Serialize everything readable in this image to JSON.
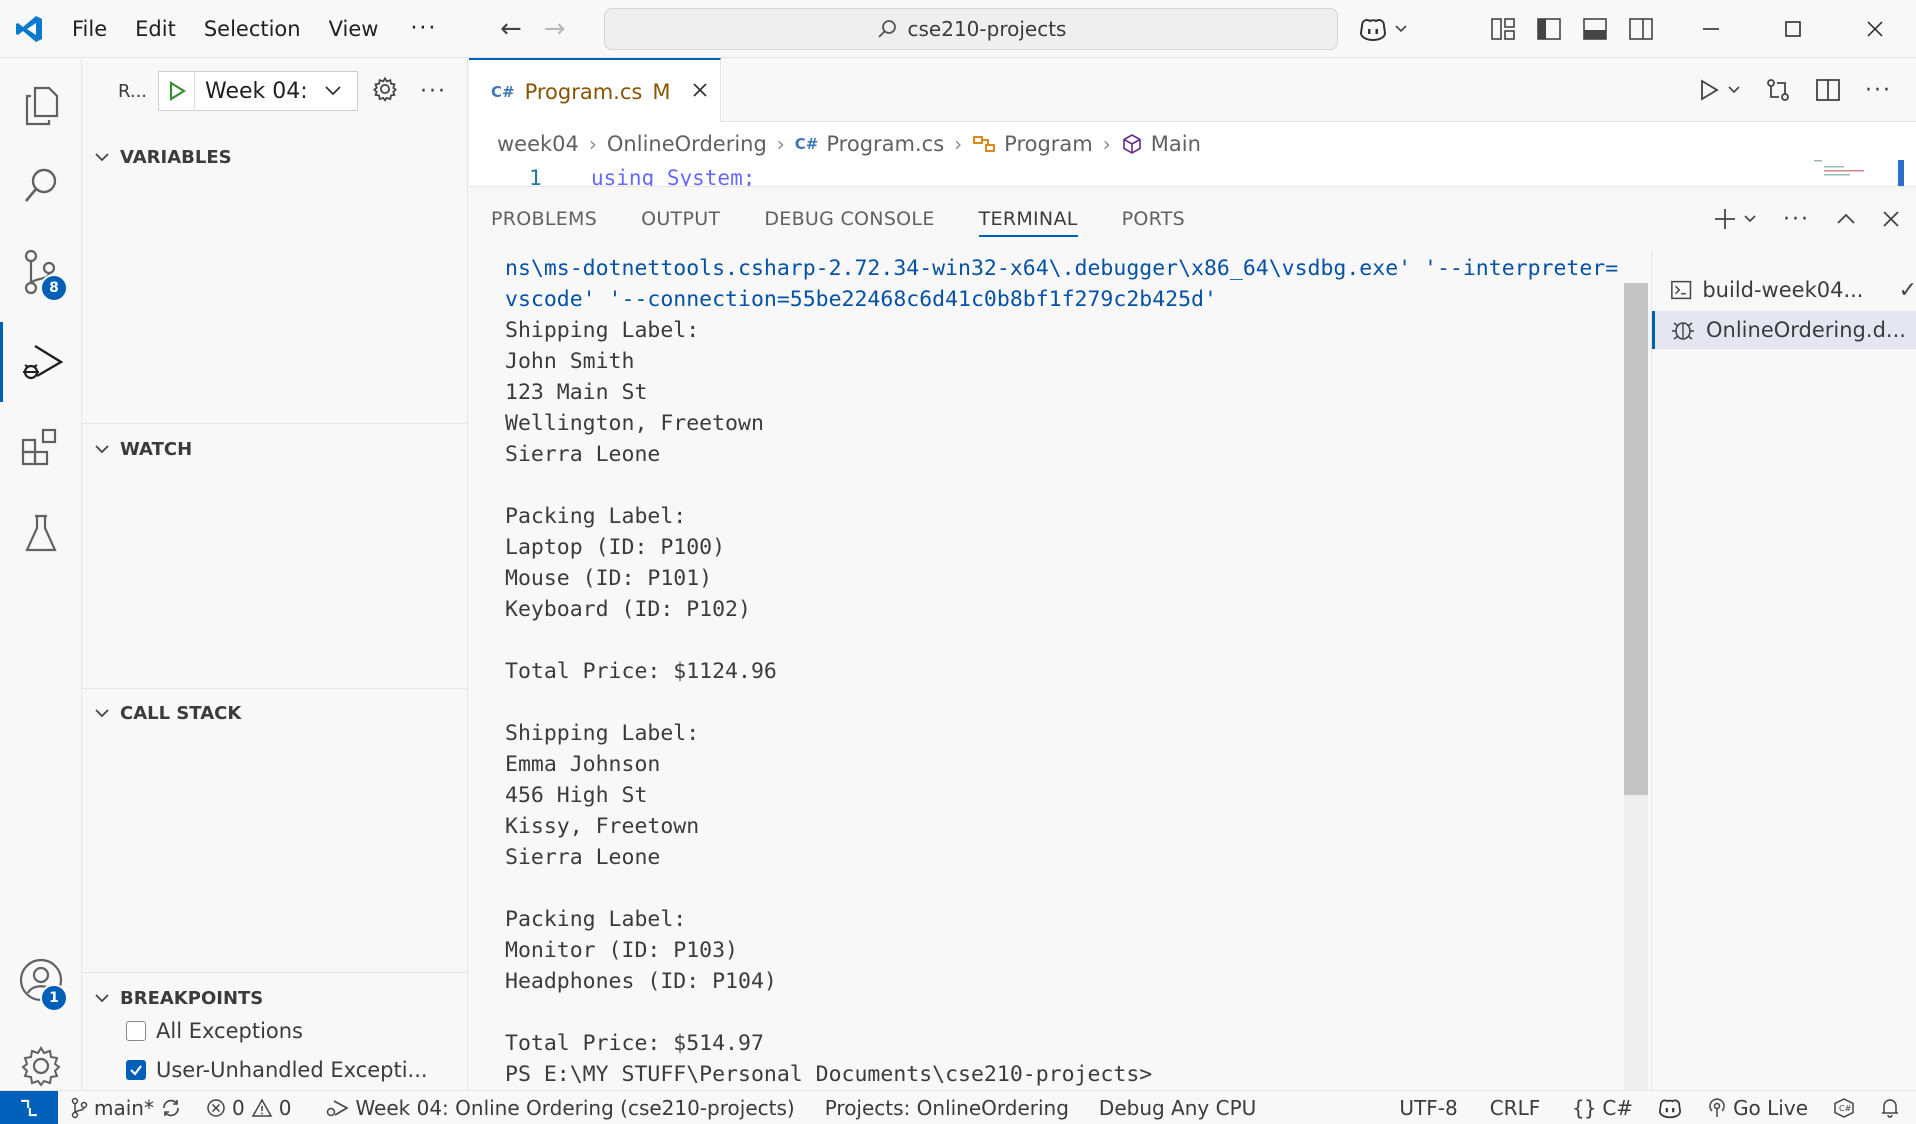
{
  "titlebar": {
    "menus": [
      "File",
      "Edit",
      "Selection",
      "View"
    ],
    "more": "···",
    "search_text": "cse210-projects"
  },
  "activitybar": {
    "source_control_badge": "8",
    "accounts_badge": "1"
  },
  "sidebar": {
    "run_label": "R...",
    "config_name": "Week 04: Online Ordering",
    "more": "···",
    "sections": {
      "variables": "VARIABLES",
      "watch": "WATCH",
      "call_stack": "CALL STACK",
      "breakpoints": "BREAKPOINTS"
    },
    "breakpoints": [
      {
        "label": "All Exceptions",
        "checked": false
      },
      {
        "label": "User-Unhandled Excepti...",
        "checked": true
      }
    ]
  },
  "editor": {
    "tab": {
      "icon_text": "C#",
      "name": "Program.cs",
      "modified": "M"
    },
    "breadcrumb": [
      "week04",
      "OnlineOrdering",
      "Program.cs",
      "Program",
      "Main"
    ],
    "line_number": "1",
    "code_line": "using System;",
    "more": "···"
  },
  "panel": {
    "tabs": [
      "PROBLEMS",
      "OUTPUT",
      "DEBUG CONSOLE",
      "TERMINAL",
      "PORTS"
    ],
    "active_tab": "TERMINAL",
    "more": "···",
    "terminal_lines": [
      "ns\\ms-dotnettools.csharp-2.72.34-win32-x64\\.debugger\\x86_64\\vsdbg.exe' '--interpreter=",
      "vscode' '--connection=55be22468c6d41c0b8bf1f279c2b425d'",
      "Shipping Label:",
      "John Smith",
      "123 Main St",
      "Wellington, Freetown",
      "Sierra Leone",
      "",
      "Packing Label:",
      "Laptop (ID: P100)",
      "Mouse (ID: P101)",
      "Keyboard (ID: P102)",
      "",
      "Total Price: $1124.96",
      "",
      "Shipping Label:",
      "Emma Johnson",
      "456 High St",
      "Kissy, Freetown",
      "Sierra Leone",
      "",
      "Packing Label:",
      "Monitor (ID: P103)",
      "Headphones (ID: P104)",
      "",
      "Total Price: $514.97",
      "PS E:\\MY STUFF\\Personal Documents\\cse210-projects>"
    ],
    "terminals": [
      {
        "label": "build-week04...",
        "icon": "terminal-icon",
        "status": "✓"
      },
      {
        "label": "OnlineOrdering.d...",
        "icon": "debug-icon",
        "status": ""
      }
    ]
  },
  "statusbar": {
    "branch": "main*",
    "errors": "0",
    "warnings": "0",
    "debug_config": "Week 04: Online Ordering (cse210-projects)",
    "project": "Projects: OnlineOrdering",
    "debug_cpu": "Debug Any CPU",
    "encoding": "UTF-8",
    "eol": "CRLF",
    "language": "C#",
    "go_live": "Go Live"
  },
  "colors": {
    "accent": "#005fb8",
    "modified_tab": "#895503",
    "terminal_cmd": "#0451a5",
    "debug_green": "#388a34"
  }
}
